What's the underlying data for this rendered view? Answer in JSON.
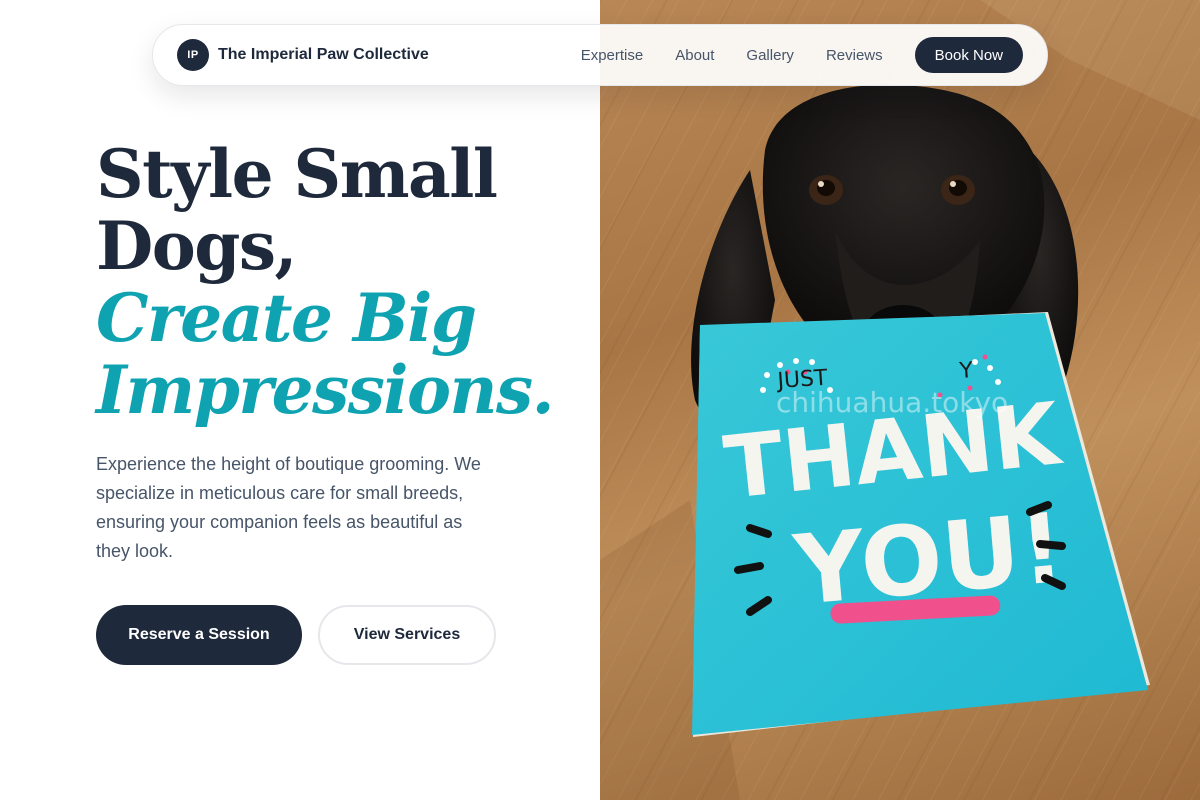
{
  "nav": {
    "brand_initials": "IP",
    "brand_name": "The Imperial Paw Collective",
    "links": [
      "Expertise",
      "About",
      "Gallery",
      "Reviews"
    ],
    "cta": "Book Now"
  },
  "hero": {
    "title_line1": "Style Small",
    "title_line2": "Dogs,",
    "accent_line1": "Create Big",
    "accent_line2": "Impressions.",
    "description": "Experience the height of boutique grooming. We specialize in meticulous care for small breeds, ensuring your companion feels as beautiful as they look.",
    "primary_button": "Reserve a Session",
    "secondary_button": "View Services"
  },
  "photo": {
    "card_top": "JUST",
    "card_top_right": "Y",
    "card_line1": "THANK",
    "card_line2": "YOU!",
    "watermark": "chihuahua.tokyo"
  },
  "colors": {
    "navy": "#1e293b",
    "accent_teal": "#0fa3b1",
    "card_cyan": "#2cc9dc",
    "card_pink": "#f0508c"
  }
}
